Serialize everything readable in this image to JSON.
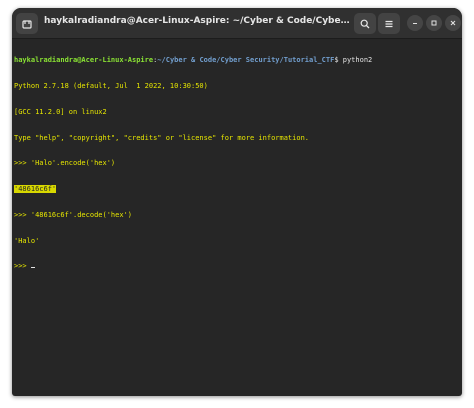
{
  "window": {
    "title": "haykalradiandra@Acer-Linux-Aspire: ~/Cyber & Code/Cyber Security/Tutorial_CTF",
    "icons": {
      "new_tab": "new-tab-icon",
      "search": "search-icon",
      "menu": "hamburger-menu-icon",
      "minimize": "minimize-icon",
      "maximize": "maximize-icon",
      "close": "close-icon"
    }
  },
  "terminal": {
    "prompt_user": "haykalradiandra@Acer-Linux-Aspire",
    "prompt_sep": ":",
    "prompt_path": "~/Cyber & Code/Cyber Security/Tutorial_CTF",
    "prompt_end": "$ ",
    "command": "python2",
    "lines": [
      "Python 2.7.18 (default, Jul  1 2022, 10:30:50)",
      "[GCC 11.2.0] on linux2",
      "Type \"help\", \"copyright\", \"credits\" or \"license\" for more information.",
      ">>> 'Halo'.encode('hex')",
      "'48616c6f'",
      ">>> '48616c6f'.decode('hex')",
      "'Halo'",
      ">>> "
    ]
  },
  "colors": {
    "background": "#262626",
    "titlebar": "#303030",
    "prompt_user": "#8ae234",
    "prompt_path": "#729fcf",
    "output_text": "#e6e600",
    "highlight": "#d8d800"
  }
}
